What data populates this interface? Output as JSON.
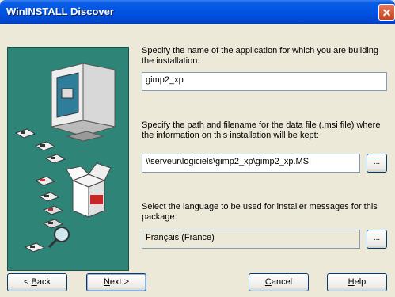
{
  "window": {
    "title": "WinINSTALL Discover"
  },
  "app_name": {
    "label": "Specify the name of the application for which you are building the installation:",
    "value": "gimp2_xp"
  },
  "data_file": {
    "label": "Specify the path and filename for the data file (.msi file) where the information on this installation will be kept:",
    "value": "\\\\serveur\\logiciels\\gimp2_xp\\gimp2_xp.MSI",
    "browse_label": "..."
  },
  "language": {
    "label": "Select the language to be used for installer messages for this package:",
    "value": "Français (France)",
    "browse_label": "..."
  },
  "buttons": {
    "back": {
      "prefix": "< ",
      "accel": "B",
      "rest": "ack"
    },
    "next": {
      "accel": "N",
      "rest": "ext >"
    },
    "cancel": {
      "accel": "C",
      "rest": "ancel"
    },
    "help": {
      "accel": "H",
      "rest": "elp"
    }
  },
  "colors": {
    "title_bar": "#0054E3",
    "art_panel": "#2E8477",
    "dialog_bg": "#ECE9D8"
  },
  "icons": [
    "close-icon",
    "monitor-icon",
    "floppy-disk-icon",
    "open-box-icon",
    "magnifier-icon"
  ]
}
